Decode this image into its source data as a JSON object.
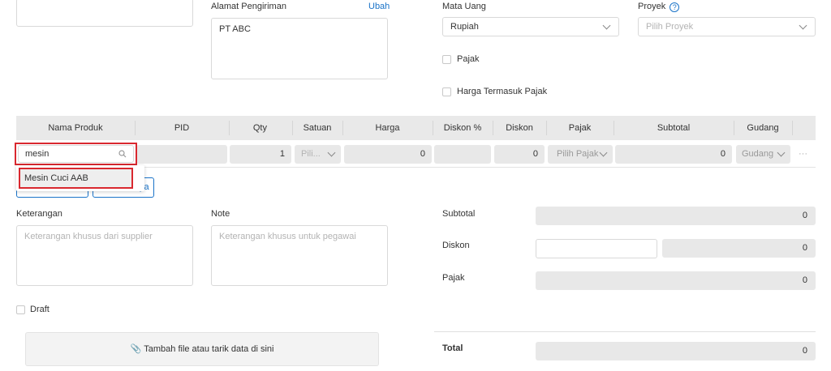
{
  "shipping": {
    "label": "Alamat Pengiriman",
    "edit_link": "Ubah",
    "address": "PT ABC"
  },
  "currency": {
    "label": "Mata Uang",
    "value": "Rupiah"
  },
  "project": {
    "label": "Proyek",
    "placeholder": "Pilih Proyek"
  },
  "tax_checkbox": "Pajak",
  "tax_included_checkbox": "Harga Termasuk Pajak",
  "table": {
    "headers": [
      "Nama Produk",
      "PID",
      "Qty",
      "Satuan",
      "Harga",
      "Diskon %",
      "Diskon",
      "Pajak",
      "Subtotal",
      "Gudang"
    ],
    "row": {
      "product": "mesin",
      "qty": "1",
      "unit": "Pili...",
      "price": "0",
      "discount": "0",
      "tax": "Pilih Pajak",
      "subtotal": "0",
      "warehouse": "Gudang",
      "more": "···"
    },
    "suggestion": "Mesin Cuci AAB",
    "hidden_button_tail": "ya"
  },
  "notes": {
    "supplier_label": "Keterangan",
    "supplier_placeholder": "Keterangan khusus dari supplier",
    "employee_label": "Note",
    "employee_placeholder": "Keterangan khusus untuk pegawai"
  },
  "draft_label": "Draft",
  "attach_label": "Tambah file atau tarik data di sini",
  "summary": {
    "subtotal_label": "Subtotal",
    "subtotal_value": "0",
    "discount_label": "Diskon",
    "discount_value": "0",
    "tax_label": "Pajak",
    "tax_value": "0",
    "total_label": "Total",
    "total_value": "0"
  },
  "colors": {
    "accent": "#1a73c8",
    "highlight": "#d9282f",
    "header_bg": "#e9e9e9"
  }
}
